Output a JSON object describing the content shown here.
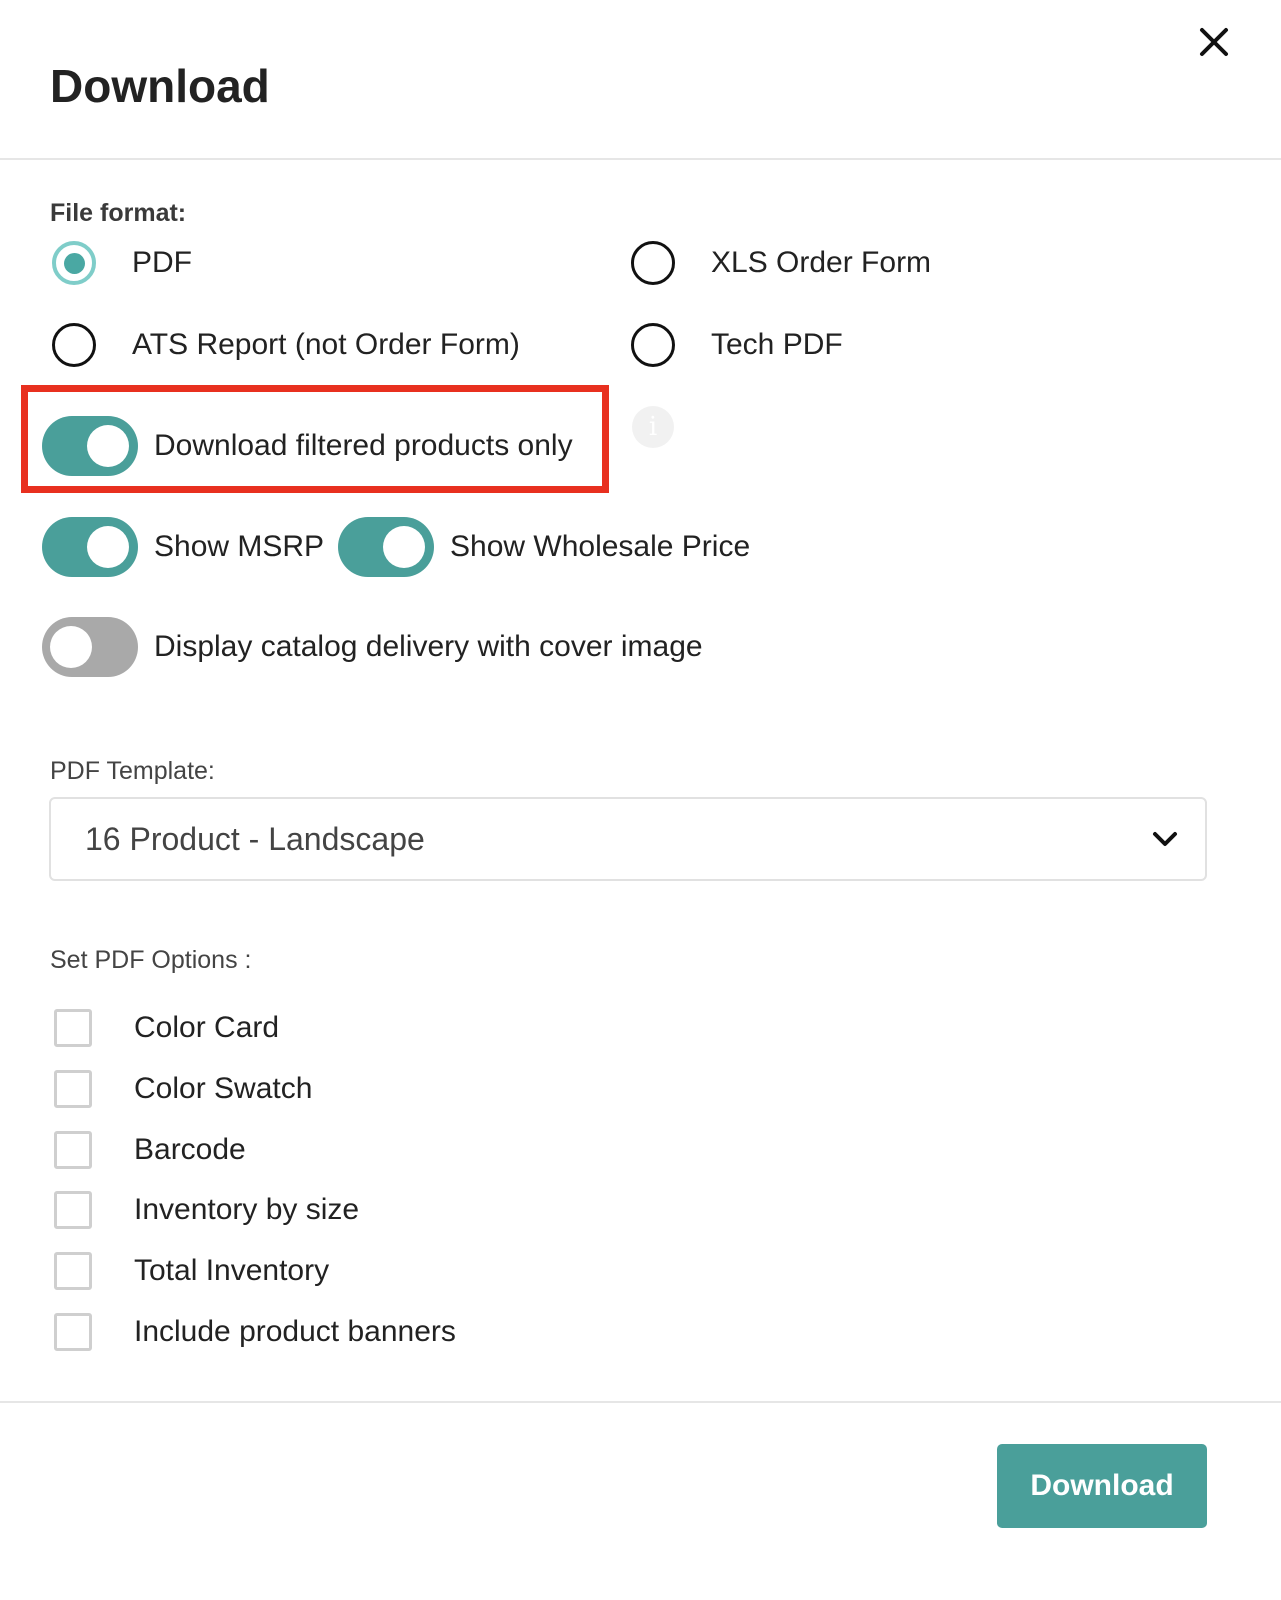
{
  "dialog": {
    "title": "Download",
    "close_icon": "close-icon"
  },
  "file_format": {
    "label": "File format:",
    "options": [
      {
        "label": "PDF",
        "checked": true
      },
      {
        "label": "XLS Order Form",
        "checked": false
      },
      {
        "label": "ATS Report (not Order Form)",
        "checked": false
      },
      {
        "label": "Tech PDF",
        "checked": false
      }
    ]
  },
  "toggles": {
    "filtered": {
      "label": "Download filtered products only",
      "on": true
    },
    "msrp": {
      "label": "Show MSRP",
      "on": true
    },
    "wholesale": {
      "label": "Show Wholesale Price",
      "on": true
    },
    "catalog_delivery": {
      "label": "Display catalog delivery with cover image",
      "on": false
    }
  },
  "info_icon": {
    "glyph": "i"
  },
  "pdf_template": {
    "label": "PDF Template:",
    "selected": "16 Product - Landscape"
  },
  "pdf_options": {
    "label": "Set PDF Options :",
    "items": [
      {
        "label": "Color Card",
        "checked": false
      },
      {
        "label": "Color Swatch",
        "checked": false
      },
      {
        "label": "Barcode",
        "checked": false
      },
      {
        "label": "Inventory by size",
        "checked": false
      },
      {
        "label": "Total Inventory",
        "checked": false
      },
      {
        "label": "Include product banners",
        "checked": false
      }
    ]
  },
  "footer": {
    "download_label": "Download"
  },
  "colors": {
    "accent": "#4a9f9a",
    "highlight": "#e8301f",
    "toggle_off": "#a9a9a9"
  }
}
